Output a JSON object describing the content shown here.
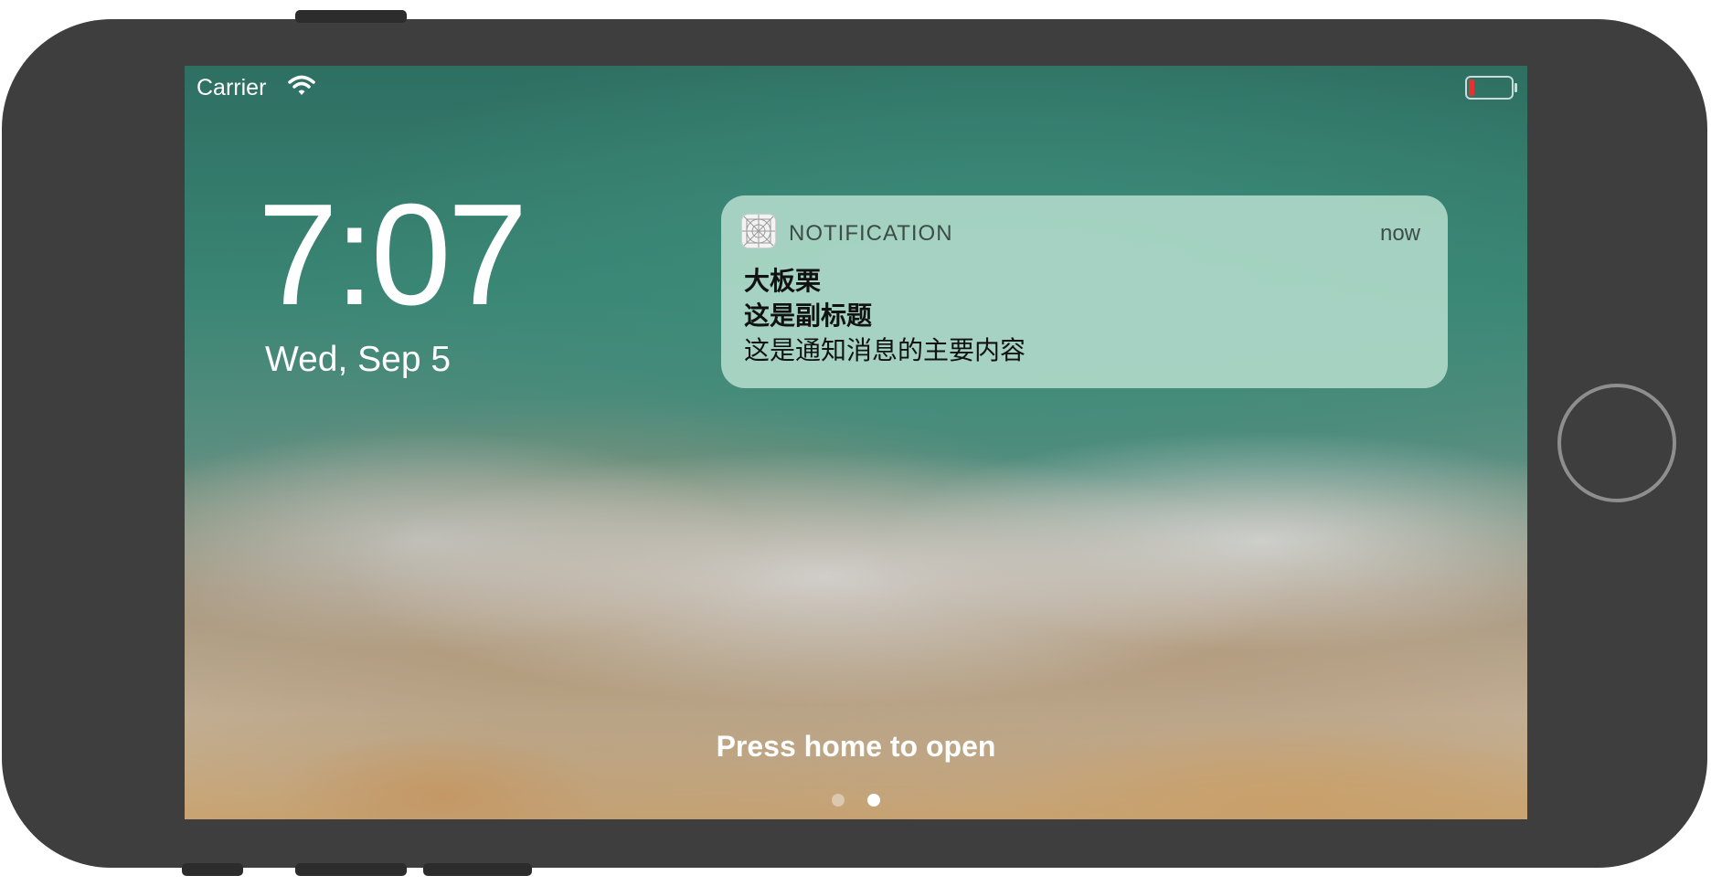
{
  "status_bar": {
    "carrier": "Carrier",
    "wifi_icon": "wifi-icon",
    "battery_icon": "battery-low-icon",
    "battery_color": "#e0352f"
  },
  "lock_screen": {
    "time": "7:07",
    "date": "Wed, Sep 5",
    "unlock_hint": "Press home to open",
    "page_indicator": {
      "count": 2,
      "active_index": 1
    }
  },
  "notification": {
    "app_name": "NOTIFICATION",
    "app_icon": "app-placeholder-icon",
    "timestamp": "now",
    "title": "大板栗",
    "subtitle": "这是副标题",
    "body": "这是通知消息的主要内容"
  },
  "device": {
    "home_button": "home-button"
  }
}
